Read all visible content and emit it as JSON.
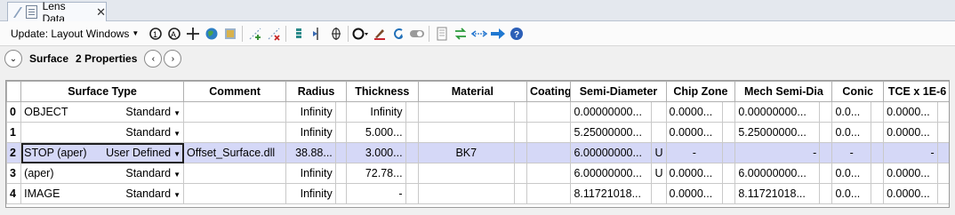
{
  "tab": {
    "label": "Lens Data",
    "close": "✕"
  },
  "toolbar": {
    "update_label": "Update: Layout Windows",
    "icons": [
      "refresh-icon",
      "auto-refresh-icon",
      "crosshair-icon",
      "globe-icon",
      "gallery-icon",
      "add-point-icon",
      "remove-point-icon",
      "stack-icon",
      "split-icon",
      "axis-icon",
      "circle-menu-icon",
      "paint-icon",
      "undo-icon",
      "toggle-icon",
      "page-icon",
      "swap-icon",
      "arrows-icon",
      "forward-icon",
      "help-icon"
    ]
  },
  "properties": {
    "title": "Surface",
    "count": "2 Properties"
  },
  "grid": {
    "columns": [
      "",
      "Surface Type",
      "Comment",
      "Radius",
      "",
      "Thickness",
      "",
      "Material",
      "",
      "Coating",
      "Semi-Diameter",
      "",
      "Chip Zone",
      "",
      "Mech Semi-Dia",
      "",
      "Conic",
      "",
      "TCE x 1E-6",
      ""
    ],
    "rows": [
      {
        "num": "0",
        "name": "OBJECT",
        "type": "Standard",
        "comment": "",
        "radius": "Infinity",
        "r_solve": "",
        "thickness": "Infinity",
        "t_solve": "",
        "material": "",
        "m_solve": "",
        "coating": "",
        "semidia": "0.00000000...",
        "s_solve": "",
        "chip": "0.0000...",
        "c_solve": "",
        "mech": "0.00000000...",
        "me_solve": "",
        "conic": "0.0...",
        "co_solve": "",
        "tce": "0.0000...",
        "tc_solve": ""
      },
      {
        "num": "1",
        "name": "",
        "type": "Standard",
        "comment": "",
        "radius": "Infinity",
        "r_solve": "",
        "thickness": "5.000...",
        "t_solve": "",
        "material": "",
        "m_solve": "",
        "coating": "",
        "semidia": "5.25000000...",
        "s_solve": "",
        "chip": "0.0000...",
        "c_solve": "",
        "mech": "5.25000000...",
        "me_solve": "",
        "conic": "0.0...",
        "co_solve": "",
        "tce": "0.0000...",
        "tc_solve": ""
      },
      {
        "num": "2",
        "name": "STOP (aper)",
        "type": "User Defined",
        "comment": "Offset_Surface.dll",
        "radius": "38.88...",
        "r_solve": "",
        "thickness": "3.000...",
        "t_solve": "",
        "material": "BK7",
        "m_solve": "",
        "coating": "",
        "semidia": "6.00000000...",
        "s_solve": "U",
        "chip": "-",
        "c_solve": "",
        "mech": "-",
        "me_solve": "",
        "conic": "-",
        "co_solve": "",
        "tce": "-",
        "tc_solve": ""
      },
      {
        "num": "3",
        "name": "(aper)",
        "type": "Standard",
        "comment": "",
        "radius": "Infinity",
        "r_solve": "",
        "thickness": "72.78...",
        "t_solve": "",
        "material": "",
        "m_solve": "",
        "coating": "",
        "semidia": "6.00000000...",
        "s_solve": "U",
        "chip": "0.0000...",
        "c_solve": "",
        "mech": "6.00000000...",
        "me_solve": "",
        "conic": "0.0...",
        "co_solve": "",
        "tce": "0.0000...",
        "tc_solve": ""
      },
      {
        "num": "4",
        "name": "IMAGE",
        "type": "Standard",
        "comment": "",
        "radius": "Infinity",
        "r_solve": "",
        "thickness": "-",
        "t_solve": "",
        "material": "",
        "m_solve": "",
        "coating": "",
        "semidia": "8.11721018...",
        "s_solve": "",
        "chip": "0.0000...",
        "c_solve": "",
        "mech": "8.11721018...",
        "me_solve": "",
        "conic": "0.0...",
        "co_solve": "",
        "tce": "0.0000...",
        "tc_solve": ""
      }
    ]
  }
}
